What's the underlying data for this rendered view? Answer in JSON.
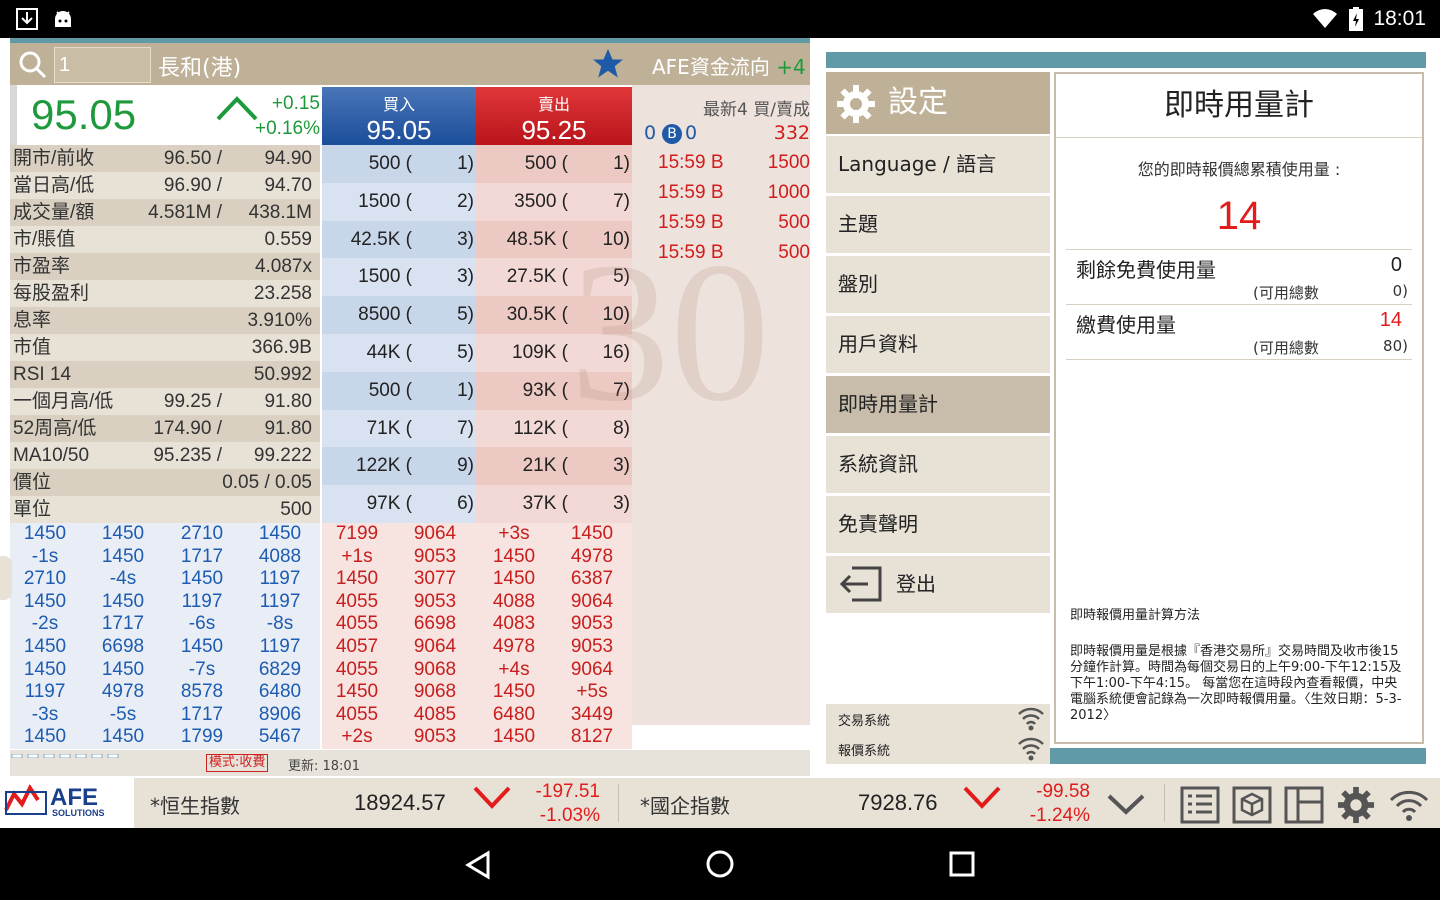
{
  "status_bar": {
    "time": "18:01",
    "icons": [
      "download-icon",
      "android-icon",
      "wifi-icon",
      "battery-icon"
    ]
  },
  "quote": {
    "search_value": "1",
    "stock_name": "長和(港)",
    "last_price": "95.05",
    "change": "+0.15",
    "change_pct": "+0.16%",
    "bid_label": "買入",
    "bid_price": "95.05",
    "ask_label": "賣出",
    "ask_price": "95.25"
  },
  "stats": [
    {
      "label": "開市/前收",
      "v1": "96.50 /",
      "v2": "94.90"
    },
    {
      "label": "當日高/低",
      "v1": "96.90 /",
      "v2": "94.70"
    },
    {
      "label": "成交量/額",
      "v1": "4.581M /",
      "v2": "438.1M"
    },
    {
      "label": "市/賬值",
      "v1": "",
      "v2": "0.559"
    },
    {
      "label": "市盈率",
      "v1": "",
      "v2": "4.087x"
    },
    {
      "label": "每股盈利",
      "v1": "",
      "v2": "23.258"
    },
    {
      "label": "息率",
      "v1": "",
      "v2": "3.910%"
    },
    {
      "label": "市值",
      "v1": "",
      "v2": "366.9B"
    },
    {
      "label": "RSI 14",
      "v1": "",
      "v2": "50.992"
    },
    {
      "label": "一個月高/低",
      "v1": "99.25 /",
      "v2": "91.80"
    },
    {
      "label": "52周高/低",
      "v1": "174.90 /",
      "v2": "91.80"
    },
    {
      "label": "MA10/50",
      "v1": "95.235 /",
      "v2": "99.222"
    },
    {
      "label": "價位",
      "v1": "",
      "v2": "0.05 / 0.05"
    },
    {
      "label": "單位",
      "v1": "",
      "v2": "500"
    }
  ],
  "depth": [
    {
      "bq": "500 (",
      "bc": "1)",
      "aq": "500 (",
      "ac": "1)"
    },
    {
      "bq": "1500 (",
      "bc": "2)",
      "aq": "3500 (",
      "ac": "7)"
    },
    {
      "bq": "42.5K (",
      "bc": "3)",
      "aq": "48.5K (",
      "ac": "10)"
    },
    {
      "bq": "1500 (",
      "bc": "3)",
      "aq": "27.5K (",
      "ac": "5)"
    },
    {
      "bq": "8500 (",
      "bc": "5)",
      "aq": "30.5K (",
      "ac": "10)"
    },
    {
      "bq": "44K (",
      "bc": "5)",
      "aq": "109K (",
      "ac": "16)"
    },
    {
      "bq": "500 (",
      "bc": "1)",
      "aq": "93K (",
      "ac": "7)"
    },
    {
      "bq": "71K (",
      "bc": "7)",
      "aq": "112K (",
      "ac": "8)"
    },
    {
      "bq": "122K (",
      "bc": "9)",
      "aq": "21K (",
      "ac": "3)"
    },
    {
      "bq": "97K (",
      "bc": "6)",
      "aq": "37K (",
      "ac": "3)"
    }
  ],
  "ticks_left": [
    [
      "1450",
      "1450",
      "2710",
      "1450"
    ],
    [
      "-1s",
      "1450",
      "1717",
      "4088"
    ],
    [
      "2710",
      "-4s",
      "1450",
      "1197"
    ],
    [
      "1450",
      "1450",
      "1197",
      "1197"
    ],
    [
      "-2s",
      "1717",
      "-6s",
      "-8s"
    ],
    [
      "1450",
      "6698",
      "1450",
      "1197"
    ],
    [
      "1450",
      "1450",
      "-7s",
      "6829"
    ],
    [
      "1197",
      "4978",
      "8578",
      "6480"
    ],
    [
      "-3s",
      "-5s",
      "1717",
      "8906"
    ],
    [
      "1450",
      "1450",
      "1799",
      "5467"
    ]
  ],
  "ticks_right": [
    [
      "7199",
      "9064",
      "+3s",
      "1450"
    ],
    [
      "+1s",
      "9053",
      "1450",
      "4978"
    ],
    [
      "1450",
      "3077",
      "1450",
      "6387"
    ],
    [
      "4055",
      "9053",
      "4088",
      "9064"
    ],
    [
      "4055",
      "6698",
      "4083",
      "9053"
    ],
    [
      "4057",
      "9064",
      "4978",
      "9053"
    ],
    [
      "4055",
      "9068",
      "+4s",
      "9064"
    ],
    [
      "1450",
      "9068",
      "1450",
      "+5s"
    ],
    [
      "4055",
      "4085",
      "6480",
      "3449"
    ],
    [
      "+2s",
      "9053",
      "1450",
      "8127"
    ]
  ],
  "trades_panel": {
    "title": "AFE資金流向",
    "title_suffix": "+4",
    "header": "最新4 買/賣成",
    "counts": {
      "a": "0",
      "b_badge": "B",
      "c": "0",
      "d": "332"
    },
    "rows": [
      {
        "time": "15:59 B",
        "vol": "1500"
      },
      {
        "time": "15:59 B",
        "vol": "1000"
      },
      {
        "time": "15:59 B",
        "vol": "500"
      },
      {
        "time": "15:59 B",
        "vol": "500"
      }
    ]
  },
  "footer": {
    "mode": "模式:收費",
    "updated": "更新: 18:01"
  },
  "watermark": "30",
  "settings": {
    "title": "設定",
    "items": [
      {
        "label": "Language / 語言"
      },
      {
        "label": "主題"
      },
      {
        "label": "盤別"
      },
      {
        "label": "用戶資料"
      },
      {
        "label": "即時用量計"
      },
      {
        "label": "系統資訊"
      },
      {
        "label": "免責聲明"
      },
      {
        "label": "登出"
      }
    ],
    "trading_system": "交易系統",
    "quote_system": "報價系統"
  },
  "usage": {
    "title": "即時用量計",
    "cumulative_label": "您的即時報價總累積使用量 :",
    "cumulative_value": "14",
    "free_label": "剩餘免費使用量",
    "free_value": "0",
    "free_total_label": "(可用總數",
    "free_total_value": "0)",
    "paid_label": "繳費使用量",
    "paid_value": "14",
    "paid_total_label": "(可用總數",
    "paid_total_value": "80)",
    "method_title": "即時報價用量計算方法",
    "method_desc": "即時報價用量是根據『香港交易所』交易時間及收市後15分鐘作計算。時間為每個交易日的上午9:00-下午12:15及下午1:00-下午4:15。 每當您在這時段內查看報價，中央電腦系統便會記錄為一次即時報價用量。〈生效日期：5-3-2012〉"
  },
  "bottom_bar": {
    "logo_text": "AFE",
    "logo_sub": "SOLUTIONS",
    "hsi_name": "*恒生指數",
    "hsi_value": "18924.57",
    "hsi_change": "-197.51",
    "hsi_change_pct": "-1.03%",
    "hscei_name": "*國企指數",
    "hscei_value": "7928.76",
    "hscei_change": "-99.58",
    "hscei_change_pct": "-1.24%"
  },
  "colors": {
    "up": "#1e9a3c",
    "down": "#e21b1b",
    "accent": "#5f9aa6",
    "tan": "#bfb198"
  }
}
